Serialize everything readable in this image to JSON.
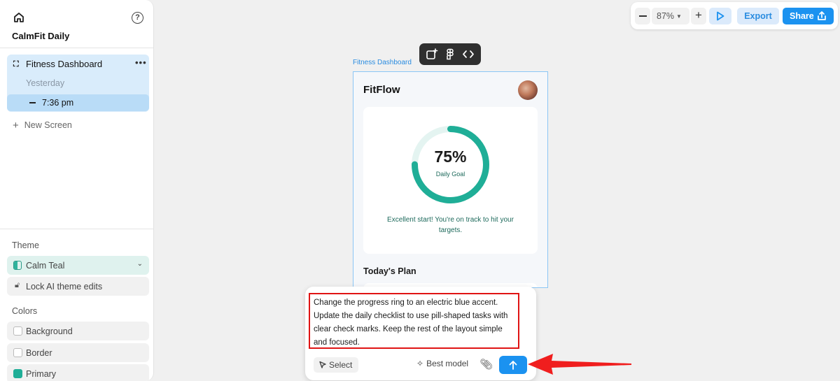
{
  "sidebar": {
    "project_name": "CalmFit Daily",
    "help_glyph": "?",
    "screen_group": {
      "icon_glyph": "⛶",
      "title": "Fitness Dashboard",
      "more_glyph": "•••",
      "date_label": "Yesterday",
      "version_time": "7:36 pm"
    },
    "new_screen_label": "New Screen",
    "theme": {
      "section_label": "Theme",
      "selected": "Calm Teal",
      "lock_label": "Lock AI theme edits"
    },
    "colors": {
      "section_label": "Colors",
      "items": [
        {
          "label": "Background",
          "color": "#ffffff"
        },
        {
          "label": "Border",
          "color": "#ffffff"
        },
        {
          "label": "Primary",
          "color": "#1fae97"
        }
      ]
    }
  },
  "toolbar": {
    "zoom": "87%",
    "export_label": "Export",
    "share_label": "Share",
    "accent_color": "#1b92f0"
  },
  "canvas": {
    "frame_label": "Fitness Dashboard",
    "mini_toolbar_icons": [
      "add-screen-icon",
      "figma-icon",
      "code-icon"
    ]
  },
  "app": {
    "title": "FitFlow",
    "goal": {
      "percent_text": "75%",
      "progress": 0.75,
      "label": "Daily Goal",
      "message": "Excellent start! You're on track to hit your targets.",
      "ring_color": "#1fae97",
      "track_color": "#e4f4f1"
    },
    "plan_title": "Today's Plan"
  },
  "prompt": {
    "text": "Change the progress ring to an electric blue accent. Update the daily checklist to use pill-shaped tasks with clear check marks. Keep the rest of the layout simple and focused.",
    "select_label": "Select",
    "model_label": "Best model",
    "highlight_color": "#e01414"
  }
}
